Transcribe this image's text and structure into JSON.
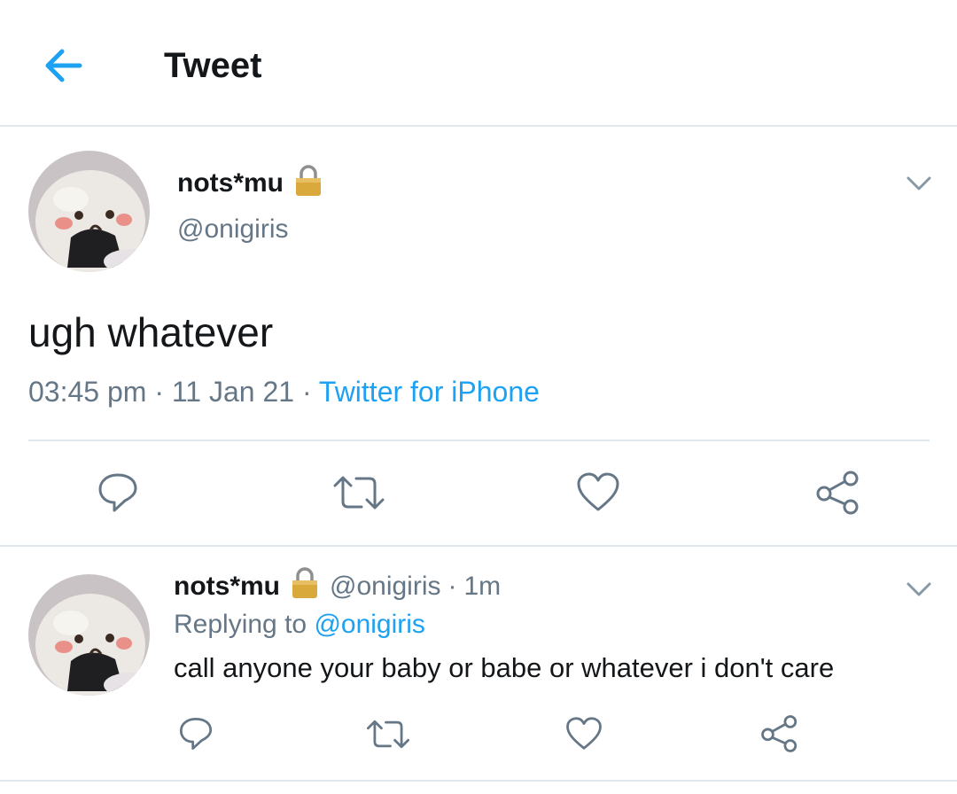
{
  "header": {
    "title": "Tweet",
    "back_icon": "arrow-left-icon",
    "accent": "#1da1f2"
  },
  "main_tweet": {
    "display_name": "nots*mu",
    "lock_icon": "lock-icon",
    "handle": "@onigiris",
    "text": "ugh whatever",
    "time": "03:45 pm",
    "sep1": " · ",
    "date": "11 Jan 21",
    "sep2": " · ",
    "source": "Twitter for iPhone",
    "actions": [
      "reply-icon",
      "retweet-icon",
      "like-icon",
      "share-icon"
    ]
  },
  "reply_tweet": {
    "display_name": "nots*mu",
    "handle": "@onigiris",
    "sep": "·",
    "time": "1m",
    "replying_prefix": "Replying to ",
    "replying_to": "@onigiris",
    "text": "call anyone your baby or babe or whatever i don't care",
    "actions": [
      "reply-icon",
      "retweet-icon",
      "like-icon",
      "share-icon"
    ]
  },
  "colors": {
    "text": "#14171a",
    "secondary": "#657786",
    "link": "#1da1f2",
    "divider": "#e1e8ed"
  }
}
